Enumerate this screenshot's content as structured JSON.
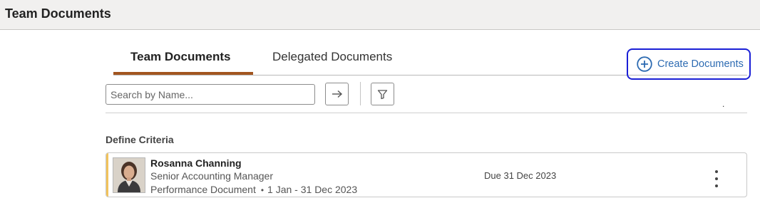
{
  "header": {
    "title": "Team Documents"
  },
  "tabs": [
    {
      "label": "Team Documents",
      "active": true
    },
    {
      "label": "Delegated Documents",
      "active": false
    }
  ],
  "actions": {
    "create_label": "Create Documents",
    "create_icon": "plus-circle-icon"
  },
  "search": {
    "placeholder": "Search by Name...",
    "value": "",
    "go_icon": "arrow-right-icon",
    "filter_icon": "filter-icon"
  },
  "marker_text": ".",
  "section": {
    "label": "Define Criteria"
  },
  "documents": [
    {
      "name": "Rosanna Channing",
      "job_title": "Senior Accounting Manager",
      "doc_type": "Performance Document",
      "separator": "•",
      "period": "1 Jan - 31 Dec 2023",
      "due": "Due 31 Dec 2023",
      "menu_icon": "more-vertical-icon"
    }
  ],
  "colors": {
    "accent_tab": "#a2551f",
    "link_blue": "#2d6bb2",
    "focus_ring": "#1a1fd6",
    "card_accent": "#f1c35c",
    "header_bg": "#f1f0ef"
  }
}
